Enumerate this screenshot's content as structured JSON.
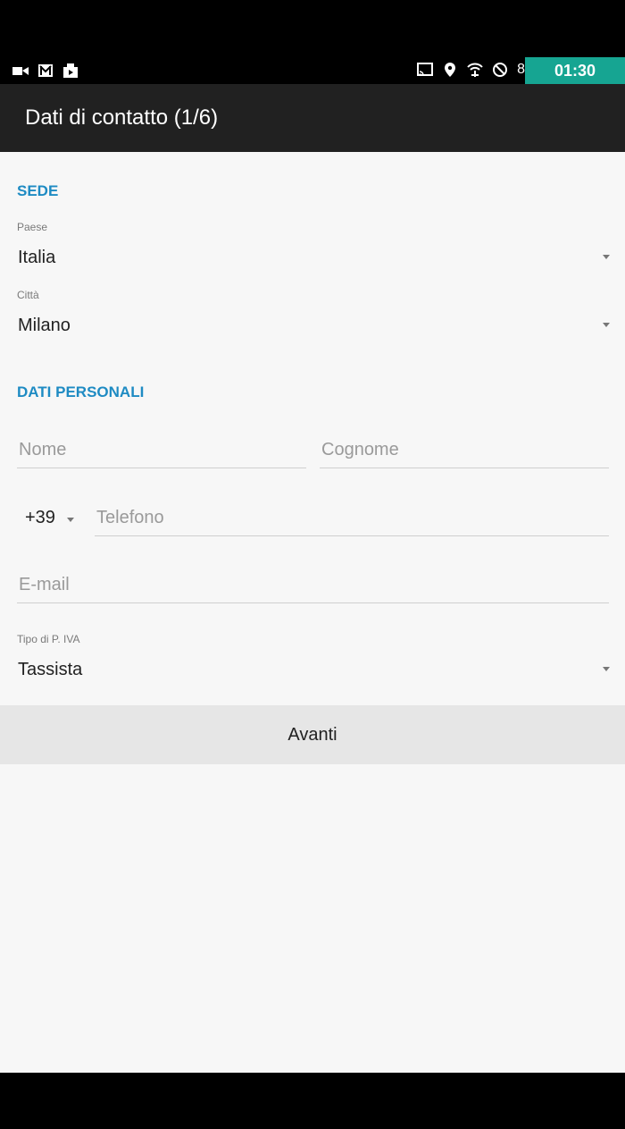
{
  "status_bar": {
    "left_icons": [
      "video-icon",
      "gmail-icon",
      "media-icon"
    ],
    "right_icons": [
      "cast-icon",
      "location-icon",
      "wifi-icon",
      "blocked-icon"
    ],
    "battery_text": "8",
    "time": "01:30",
    "clock_bg": "#16a592"
  },
  "app_bar": {
    "title": "Dati di contatto (1/6)"
  },
  "sede": {
    "title": "SEDE",
    "country_label": "Paese",
    "country_value": "Italia",
    "city_label": "Città",
    "city_value": "Milano"
  },
  "personal": {
    "title": "DATI PERSONALI",
    "first_name_placeholder": "Nome",
    "last_name_placeholder": "Cognome",
    "phone_prefix": "+39",
    "phone_placeholder": "Telefono",
    "email_placeholder": "E-mail",
    "vat_label": "Tipo di P. IVA",
    "vat_value": "Tassista"
  },
  "actions": {
    "next_label": "Avanti"
  },
  "colors": {
    "accent": "#1e8bc3",
    "app_bar": "#212121",
    "background": "#f7f7f7"
  }
}
